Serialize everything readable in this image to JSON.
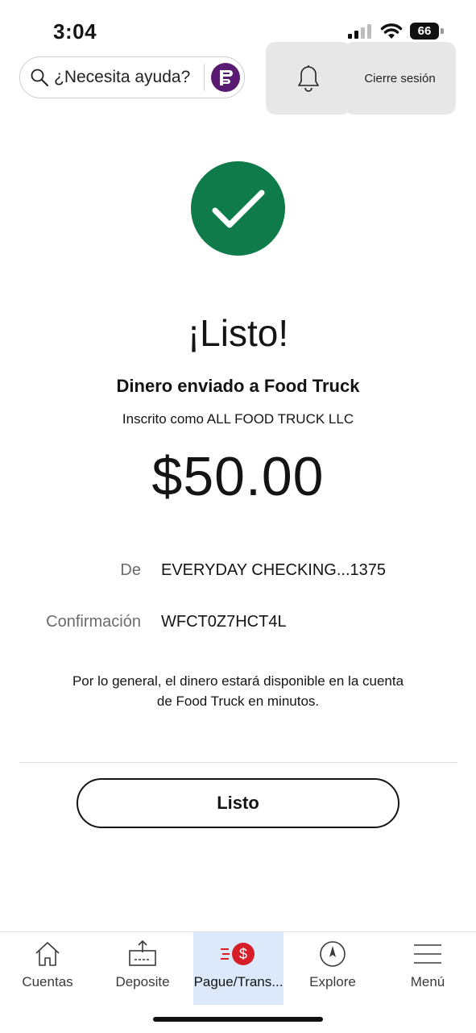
{
  "status_bar": {
    "time": "3:04",
    "battery": "66"
  },
  "header": {
    "search_placeholder": "¿Necesita ayuda?",
    "logout_label": "Cierre sesión"
  },
  "confirmation": {
    "headline": "¡Listo!",
    "subtitle": "Dinero enviado a Food Truck",
    "enrolled_as": "Inscrito como ALL FOOD TRUCK LLC",
    "amount": "$50.00",
    "from_label": "De",
    "from_value": "EVERYDAY CHECKING...1375",
    "confirmation_label": "Confirmación",
    "confirmation_value": "WFCT0Z7HCT4L",
    "note": "Por lo general, el dinero estará disponible en la cuenta de Food Truck en minutos.",
    "done_label": "Listo"
  },
  "tabs": [
    {
      "label": "Cuentas",
      "icon": "home-icon"
    },
    {
      "label": "Deposite",
      "icon": "deposit-icon"
    },
    {
      "label": "Pague/Trans...",
      "icon": "pay-transfer-icon",
      "active": true
    },
    {
      "label": "Explore",
      "icon": "compass-icon"
    },
    {
      "label": "Menú",
      "icon": "menu-icon"
    }
  ],
  "colors": {
    "success": "#0f7a4a",
    "fargo": "#5a1a72",
    "active_tab": "#dce9fb",
    "accent_red": "#d71e28"
  }
}
